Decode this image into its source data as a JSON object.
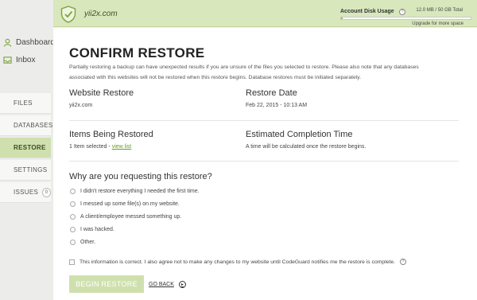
{
  "nav": {
    "dashboard": "Dashboard",
    "inbox": "Inbox"
  },
  "tabs": [
    {
      "label": "FILES"
    },
    {
      "label": "DATABASES"
    },
    {
      "label": "RESTORE"
    },
    {
      "label": "SETTINGS"
    },
    {
      "label": "ISSUES",
      "count": "0"
    }
  ],
  "header": {
    "site_name": "yii2x.com",
    "usage_label": "Account Disk Usage",
    "usage_text": "12.0 MB / 50 GB Total",
    "usage_fraction": 0.0002,
    "upgrade": "Upgrade for more space",
    "help": "?"
  },
  "restore": {
    "title": "CONFIRM RESTORE",
    "intro": "Partially restoring a backup can have unexpected results if you are unsure of the files you selected to restore. Please also note that any databases associated with this websites will not be restored when this restore begins. Database restores must be initiated separately.",
    "website_heading": "Website Restore",
    "website_value": "yii2x.com",
    "date_heading": "Restore Date",
    "date_value": "Feb 22, 2015 - 10:13 AM",
    "items_heading": "Items Being Restored",
    "items_value": "1 Item selected - ",
    "view_list": "view list",
    "eta_heading": "Estimated Completion Time",
    "eta_value": "A time will be calculated once the restore begins.",
    "question": "Why are you requesting this restore?",
    "options": [
      "I didn't restore everything I needed the first time.",
      "I messed up some file(s) on my website.",
      "A client/employee messed something up.",
      "I was hacked.",
      "Other."
    ],
    "agree": "This information is correct. I also agree not to make any changes to my website until CodeGuard notifies me the restore is complete.",
    "begin_button": "BEGIN RESTORE",
    "go_back": "GO BACK"
  },
  "colors": {
    "accent_green": "#cfe0ae",
    "header_green": "#d9e7bd",
    "link_green": "#6a9a22"
  }
}
